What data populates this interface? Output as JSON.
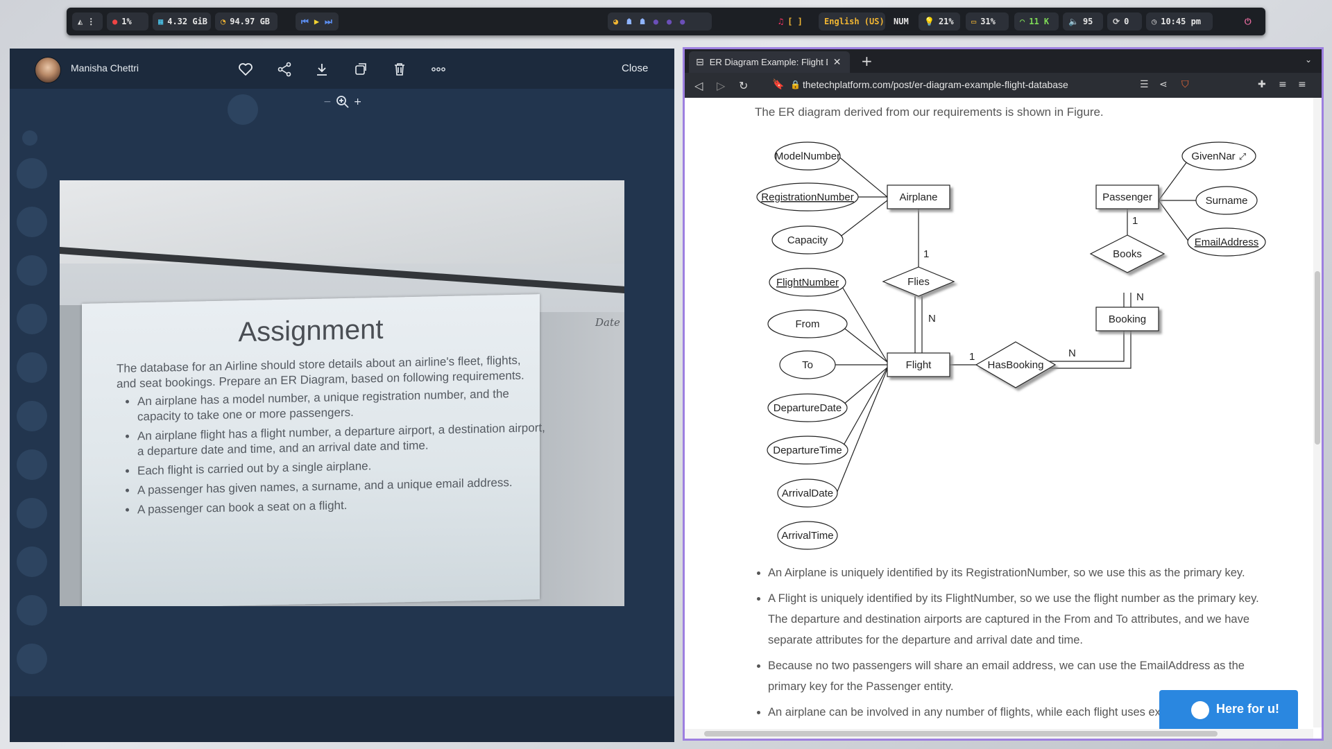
{
  "statusbar": {
    "cpu": "1%",
    "memory": "4.32 GiB",
    "disk": "94.97 GB",
    "keyboard_layout_marker": "[ ]",
    "language": "English (US)",
    "numlock": "NUM",
    "brightness": "21%",
    "battery": "31%",
    "wifi": "11 K",
    "volume": "95",
    "updates": "0",
    "clock": "10:45 pm"
  },
  "viewer": {
    "user_name": "Manisha Chettri",
    "close_label": "Close",
    "photo": {
      "title": "Assignment",
      "intro": "The database for an Airline should store details about an airline's fleet, flights, and seat bookings. Prepare an ER Diagram, based on following requirements.",
      "items": [
        "An airplane has a model number, a unique registration number, and the capacity to take one or more passengers.",
        "An airplane flight has a flight number, a departure airport, a destination airport, a departure date and time, and an arrival date and time.",
        "Each flight is carried out by a single airplane.",
        "A passenger has given names, a surname, and a unique email address.",
        "A passenger can book a seat on a flight."
      ],
      "scrawl": "Date"
    }
  },
  "browser": {
    "tab_title": "ER Diagram Example: Flight D",
    "url": "thetechplatform.com/post/er-diagram-example-flight-database",
    "intro_line": "The ER diagram derived from our requirements is shown in Figure.",
    "er": {
      "entities": {
        "airplane": "Airplane",
        "passenger": "Passenger",
        "flight": "Flight",
        "booking": "Booking"
      },
      "relationships": {
        "flies": "Flies",
        "books": "Books",
        "hasbooking": "HasBooking"
      },
      "attributes": {
        "modelnumber": "ModelNumber",
        "registrationnumber": "RegistrationNumber",
        "capacity": "Capacity",
        "flightnumber": "FlightNumber",
        "from": "From",
        "to": "To",
        "departuredate": "DepartureDate",
        "departuretime": "DepartureTime",
        "arrivaldate": "ArrivalDate",
        "arrivaltime": "ArrivalTime",
        "givennames": "GivenNar",
        "surname": "Surname",
        "emailaddress": "EmailAddress"
      },
      "cardinalities": {
        "airplane_flies": "1",
        "flies_flight": "N",
        "passenger_books": "1",
        "books_booking": "N",
        "flight_hasbooking": "1",
        "hasbooking_booking": "N"
      }
    },
    "bullets": [
      "An Airplane is uniquely identified by its RegistrationNumber, so we use this as the primary key.",
      "A Flight is uniquely identified by its FlightNumber, so we use the flight number as the primary key. The departure and destination airports are captured in the From and To attributes, and we have separate attributes for the departure and arrival date and time.",
      "Because no two passengers will share an email address, we can use the EmailAddress as the primary key for the Passenger entity.",
      "An airplane can be involved in any number of flights, while each flight uses ex"
    ],
    "chat_widget": "Here for u!"
  }
}
